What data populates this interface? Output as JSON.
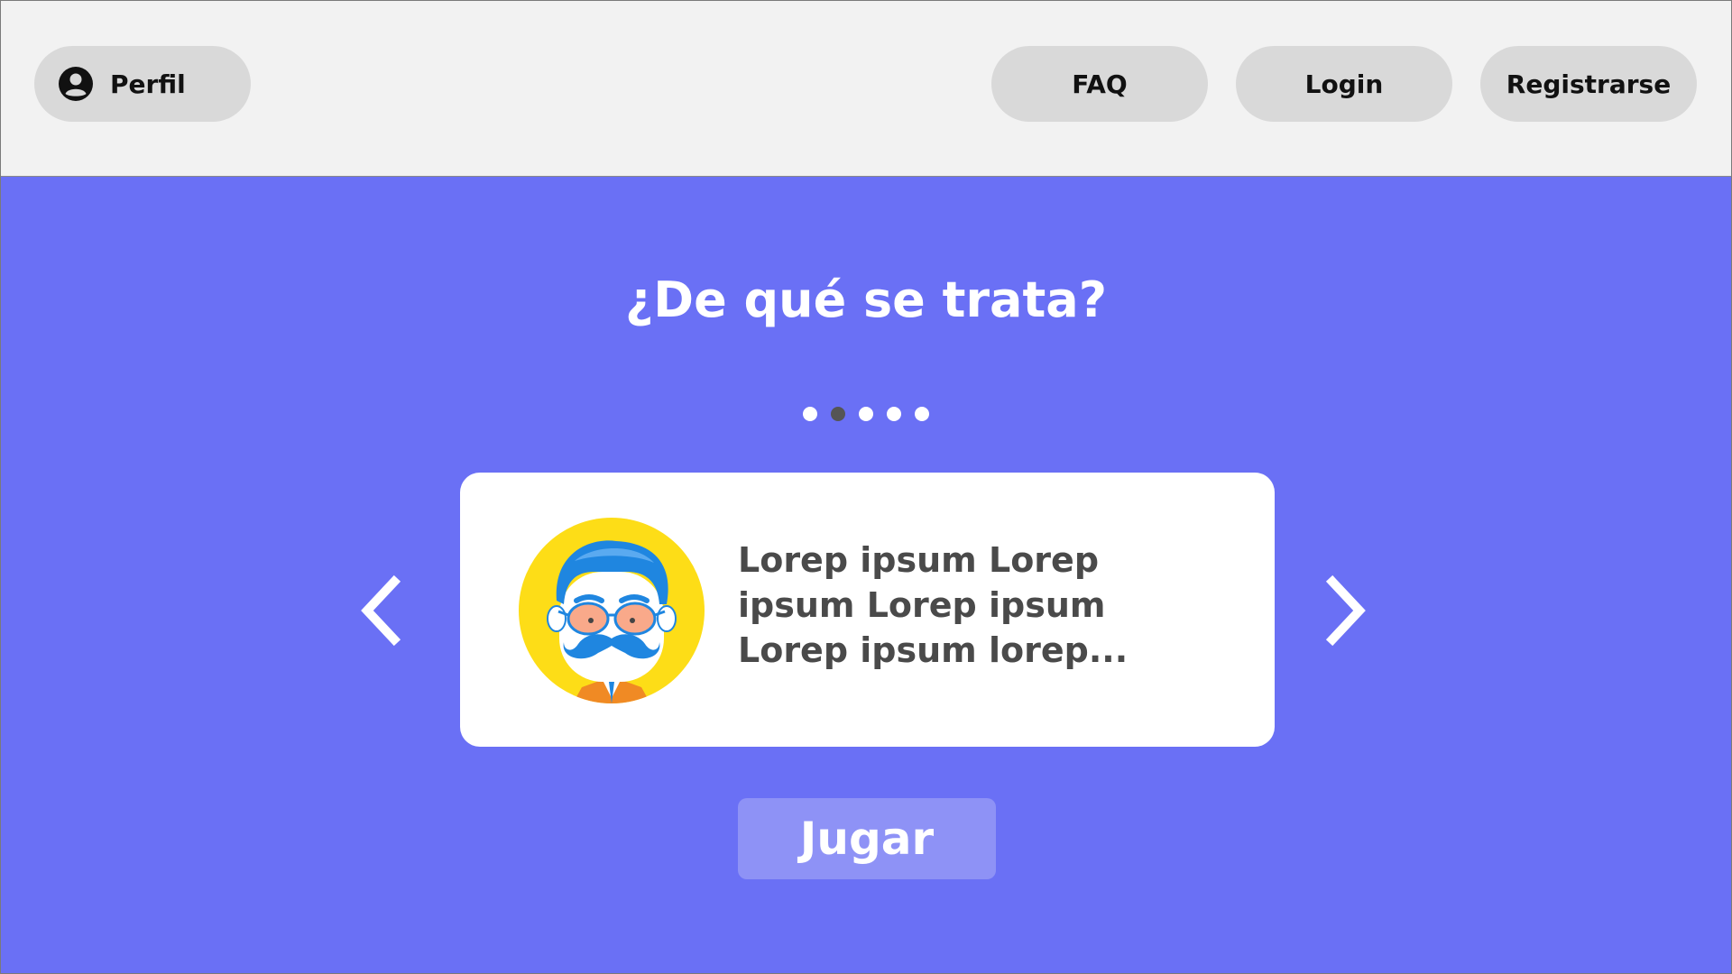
{
  "header": {
    "profile_label": "Perfil",
    "nav": {
      "faq_label": "FAQ",
      "login_label": "Login",
      "register_label": "Registrarse"
    }
  },
  "main": {
    "title": "¿De qué se trata?",
    "carousel": {
      "slide_count": 5,
      "active_index": 1,
      "card_text": "Lorep ipsum Lorep ipsum Lorep ipsum Lorep ipsum lorep...",
      "illustration": "mustached-man-avatar",
      "prev_icon": "chevron-left-icon",
      "next_icon": "chevron-right-icon"
    },
    "play_label": "Jugar"
  },
  "colors": {
    "background": "#6a70f5",
    "header_bg": "#f2f2f2",
    "pill_bg": "#d9d9d9",
    "play_bg": "#8e92f6",
    "active_dot": "#555555"
  }
}
